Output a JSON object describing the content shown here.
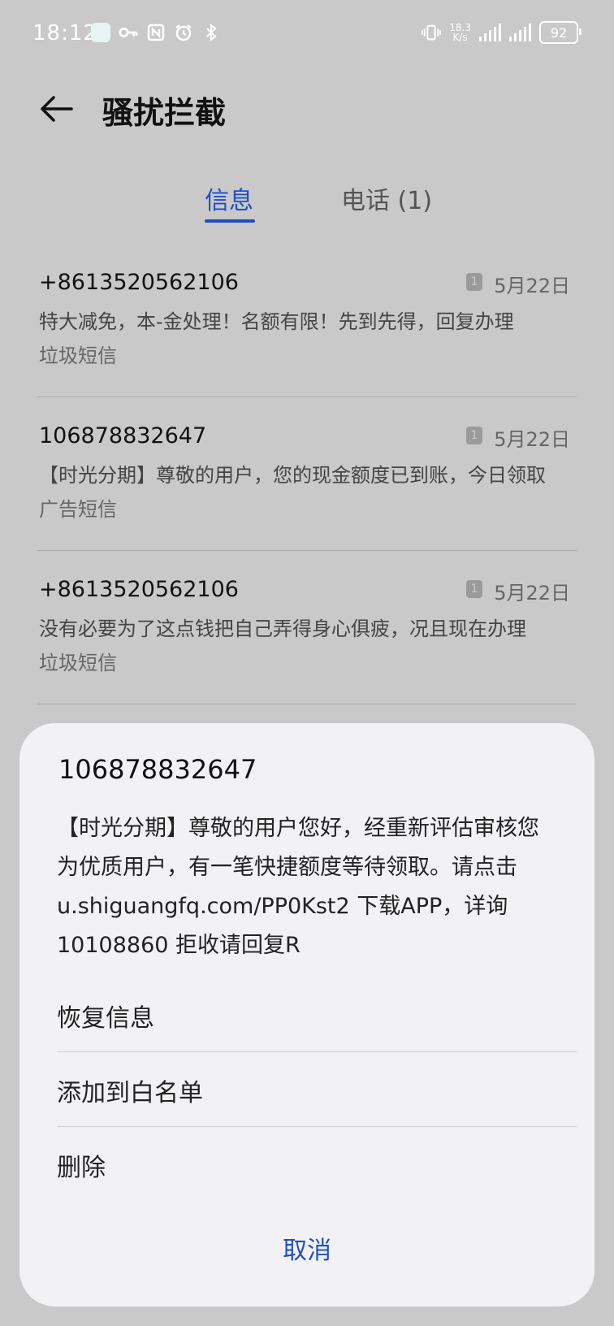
{
  "status_bar": {
    "time": "18:12",
    "net_speed_value": "18.3",
    "net_speed_unit": "K/s",
    "battery": "92"
  },
  "header": {
    "title": "骚扰拦截"
  },
  "tabs": [
    {
      "label": "信息",
      "active": true
    },
    {
      "label": "电话 (1)",
      "active": false
    }
  ],
  "messages": [
    {
      "sender": "+8613520562106",
      "sim": "1",
      "date": "5月22日",
      "preview": "特大减免，本-金处理！名额有限！先到先得，回复办理",
      "tag": "垃圾短信"
    },
    {
      "sender": "106878832647",
      "sim": "1",
      "date": "5月22日",
      "preview": "【时光分期】尊敬的用户，您的现金额度已到账，今日领取",
      "tag": "广告短信"
    },
    {
      "sender": "+8613520562106",
      "sim": "1",
      "date": "5月22日",
      "preview": "没有必要为了这点钱把自己弄得身心俱疲，况且现在办理",
      "tag": "垃圾短信"
    }
  ],
  "sheet": {
    "sender": "106878832647",
    "body": "【时光分期】尊敬的用户您好，经重新评估审核您为优质用户，有一笔快捷额度等待领取。请点击 u.shiguangfq.com/PP0Kst2 下载APP，详询10108860 拒收请回复R",
    "actions": [
      "恢复信息",
      "添加到白名单",
      "删除"
    ],
    "cancel": "取消"
  },
  "colors": {
    "accent": "#1f4fc4",
    "backdrop": "#c9c9c9",
    "sheet": "#f2f2f4"
  }
}
